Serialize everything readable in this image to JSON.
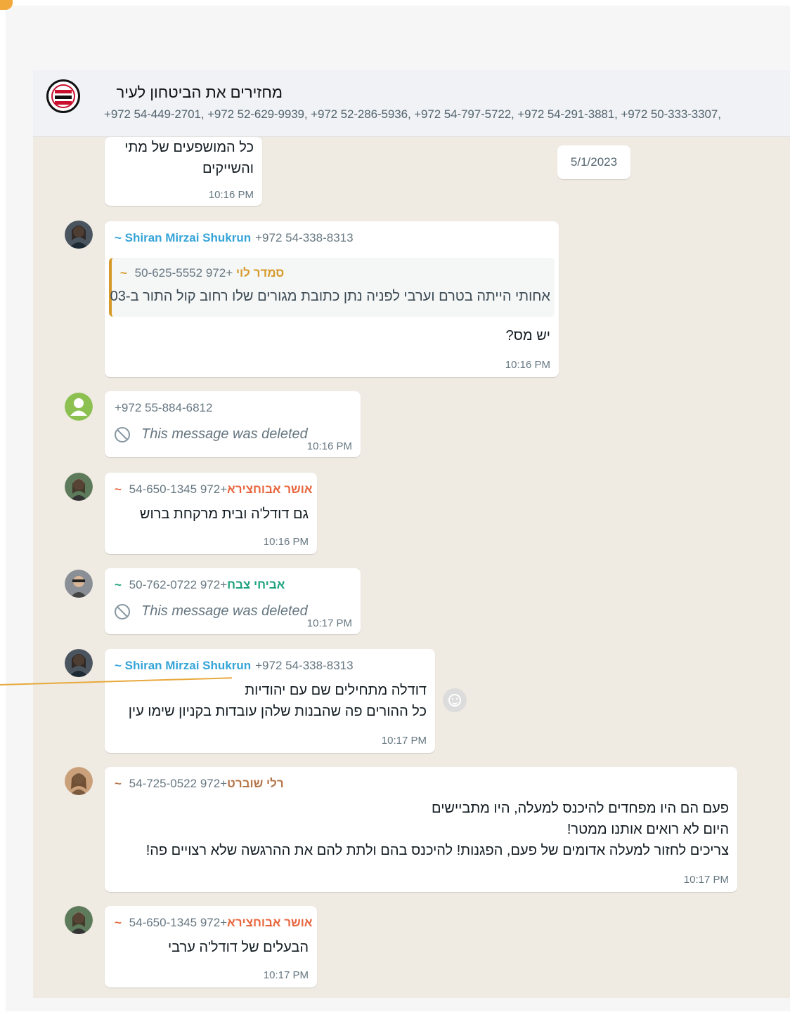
{
  "group": {
    "title": "מחזירים את הביטחון לעיר",
    "members": "+972 54-449-2701, +972 52-629-9939, +972 52-286-5936, +972 54-797-5722, +972 54-291-3881, +972 50-333-3307,",
    "avatar_icon": "group-logo-icon"
  },
  "chat": {
    "date_chip": "5/1/2023",
    "messages": [
      {
        "lines": [
          "כל המושפעים של מתי",
          "והשייקים"
        ],
        "time": "10:16 PM"
      },
      {
        "sender_name": "~ Shiran Mirzai Shukrun",
        "sender_phone": "+972 54-338-8313",
        "sender_color": "#35a4d8",
        "quote": {
          "sender_name": "~ סמדר לוי",
          "sender_phone": "+972 50-625-5552",
          "sender_color": "#d69a2a",
          "text": "אחותי הייתה בטרם וערבי לפניה נתן כתובת מגורים שלו רחוב קול התור ב-03"
        },
        "lines": [
          "יש מס?"
        ],
        "time": "10:16 PM"
      },
      {
        "sender_phone": "+972 55-884-6812",
        "deleted_text": "This message was deleted",
        "time": "10:16 PM"
      },
      {
        "sender_name": "~ אושר אבוחצירא",
        "sender_phone": "+972 54-650-1345",
        "sender_color": "#e8663d",
        "lines": [
          "גם דודל'ה ובית מרקחת ברוש"
        ],
        "time": "10:16 PM"
      },
      {
        "sender_name": "~ אביחי צבח",
        "sender_phone": "+972 50-762-0722",
        "sender_color": "#1fa27d",
        "deleted_text": "This message was deleted",
        "time": "10:17 PM"
      },
      {
        "sender_name": "~ Shiran Mirzai Shukrun",
        "sender_phone": "+972 54-338-8313",
        "sender_color": "#35a4d8",
        "lines": [
          "דודלה מתחילים שם עם יהודיות",
          "כל ההורים פה שהבנות שלהן עובדות בקניון שימו עין"
        ],
        "time": "10:17 PM"
      },
      {
        "sender_name": "~ רלי שוברט",
        "sender_phone": "+972 54-725-0522",
        "sender_color": "#b5754a",
        "lines": [
          "פעם הם היו מפחדים להיכנס למעלה, היו מתביישים",
          "היום לא רואים אותנו ממטר!",
          "צריכים לחזור למעלה אדומים של פעם, הפגנות! להיכנס בהם ולתת להם את ההרגשה שלא רצויים פה!"
        ],
        "time": "10:17 PM"
      },
      {
        "sender_name": "~ אושר אבוחצירא",
        "sender_phone": "+972 54-650-1345",
        "sender_color": "#e8663d",
        "lines": [
          "הבעלים של דודל'ה ערבי"
        ],
        "time": "10:17 PM"
      }
    ]
  }
}
